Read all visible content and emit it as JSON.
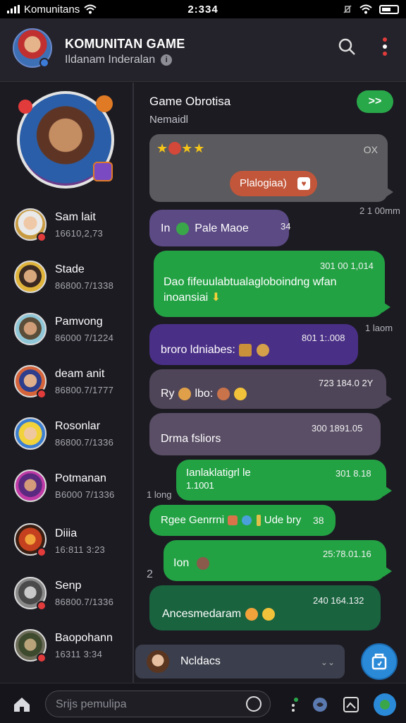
{
  "status_bar": {
    "carrier": "Komunitans",
    "clock": "2:334"
  },
  "header": {
    "title": "KOMUNITAN GAME",
    "subtitle": "Ildanam Inderalan"
  },
  "sidebar": {
    "contacts": [
      {
        "name": "Sam lait",
        "time": "16610,2,73"
      },
      {
        "name": "Stade",
        "time": "86800.7/1338"
      },
      {
        "name": "Pamvong",
        "time": "86000 7/1224"
      },
      {
        "name": "deam anit",
        "time": "86800.7/1777"
      },
      {
        "name": "Rosonlar",
        "time": "86800.7/1336"
      },
      {
        "name": "Potmanan",
        "time": "B6000 7/1336"
      },
      {
        "name": "Diiia",
        "time": "16:811 3:23"
      },
      {
        "name": "Senp",
        "time": "86800.7/1336"
      },
      {
        "name": "Baopohann",
        "time": "16311 3:34"
      }
    ]
  },
  "chat": {
    "title": "Game Obrotisa",
    "subtitle": "Nemaidl",
    "go_label": ">>",
    "pinned": {
      "close": "OX",
      "pill": "Plalogiaa)"
    },
    "side_labels": {
      "a": "2 1 00mm",
      "b": "1 laom",
      "c": "1 long",
      "d": "2"
    },
    "messages": [
      {
        "text": "In",
        "text2": "Pale Maoe",
        "time": "34"
      },
      {
        "text": "Dao fifeuulabtualagloboindng wfan inoansiai",
        "time": "301 00 1,014"
      },
      {
        "text": "broro ldniabes:",
        "time": "801 1:.008"
      },
      {
        "text": "Ry",
        "text2": "lbo:",
        "time": "723 184.0 2Y"
      },
      {
        "text": "Drma fsliors",
        "time": "300 1891.05"
      },
      {
        "text": "Ianlaklatigrl le",
        "text2": "1.1001",
        "time": "301 8.18"
      },
      {
        "text": "Rgee Genrrni",
        "text2": "Ude bry",
        "time": "38"
      },
      {
        "text": "Ion",
        "time": "25:78.01.16"
      },
      {
        "text": "Ancesmedaram",
        "time": "240 164.132"
      }
    ],
    "reply": "Ncldacs"
  },
  "bottom": {
    "placeholder": "Srijs pemulipa"
  }
}
